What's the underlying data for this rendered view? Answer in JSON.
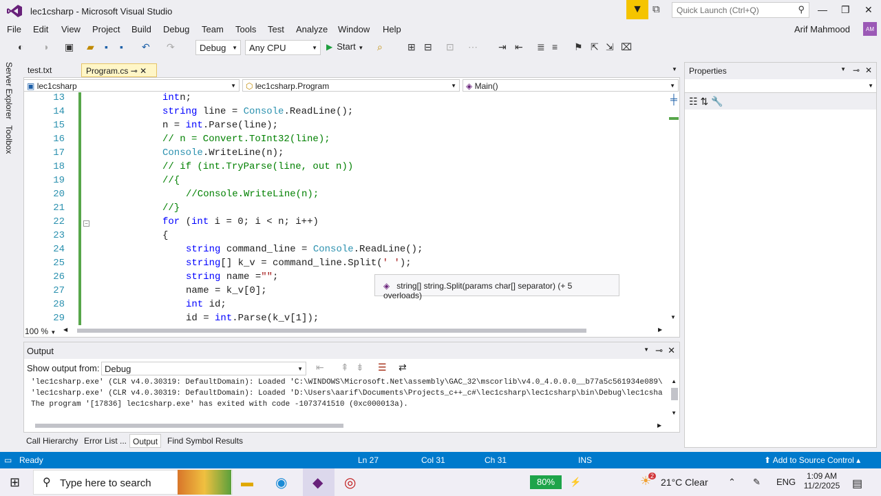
{
  "title": "lec1csharp - Microsoft Visual Studio",
  "quick_launch": {
    "placeholder": "Quick Launch (Ctrl+Q)"
  },
  "menu": [
    "File",
    "Edit",
    "View",
    "Project",
    "Build",
    "Debug",
    "Team",
    "Tools",
    "Test",
    "Analyze",
    "Window",
    "Help"
  ],
  "user": "Arif Mahmood",
  "avatar": "AM",
  "toolbar": {
    "config": "Debug",
    "platform": "Any CPU",
    "start": "Start"
  },
  "side_tabs": [
    "Server Explorer",
    "Toolbox"
  ],
  "doc_tabs": [
    {
      "label": "test.txt"
    },
    {
      "label": "Program.cs",
      "active": true
    }
  ],
  "nav": {
    "project": "lec1csharp",
    "class": "lec1csharp.Program",
    "member": "Main()"
  },
  "code": [
    {
      "n": "13",
      "t": [
        [
          "kw",
          "int"
        ],
        [
          "",
          "n;"
        ]
      ],
      "ind": 0
    },
    {
      "n": "14",
      "t": [
        [
          "kw",
          "string"
        ],
        [
          "",
          " line = "
        ],
        [
          "ty",
          "Console"
        ],
        [
          "",
          ".ReadLine();"
        ]
      ],
      "ind": 0
    },
    {
      "n": "15",
      "t": [
        [
          "",
          "n = "
        ],
        [
          "kw",
          "int"
        ],
        [
          "",
          ".Parse(line);"
        ]
      ],
      "ind": 0
    },
    {
      "n": "16",
      "t": [
        [
          "cm",
          "// n = Convert.ToInt32(line);"
        ]
      ],
      "ind": 0
    },
    {
      "n": "17",
      "t": [
        [
          "ty",
          "Console"
        ],
        [
          "",
          ".WriteLine(n);"
        ]
      ],
      "ind": 0
    },
    {
      "n": "18",
      "t": [
        [
          "cm",
          "// if (int.TryParse(line, out n))"
        ]
      ],
      "ind": 0
    },
    {
      "n": "19",
      "t": [
        [
          "cm",
          "//{"
        ]
      ],
      "ind": 0
    },
    {
      "n": "20",
      "t": [
        [
          "cm",
          "//Console.WriteLine(n);"
        ]
      ],
      "ind": 1
    },
    {
      "n": "21",
      "t": [
        [
          "cm",
          "//}"
        ]
      ],
      "ind": 0
    },
    {
      "n": "22",
      "t": [
        [
          "kw",
          "for"
        ],
        [
          "",
          " ("
        ],
        [
          "kw",
          "int"
        ],
        [
          "",
          " i = 0; i < n; i++)"
        ]
      ],
      "ind": 0
    },
    {
      "n": "23",
      "t": [
        [
          "",
          "{"
        ]
      ],
      "ind": 0
    },
    {
      "n": "24",
      "t": [
        [
          "kw",
          "string"
        ],
        [
          "",
          " command_line = "
        ],
        [
          "ty",
          "Console"
        ],
        [
          "",
          ".ReadLine();"
        ]
      ],
      "ind": 1
    },
    {
      "n": "25",
      "t": [
        [
          "kw",
          "string"
        ],
        [
          "",
          "[] k_v = command_line.Split("
        ],
        [
          "st",
          "' '"
        ],
        [
          "",
          ");"
        ]
      ],
      "ind": 1
    },
    {
      "n": "26",
      "t": [
        [
          "kw",
          "string"
        ],
        [
          "",
          " name ="
        ],
        [
          "st",
          "\"\""
        ],
        [
          "",
          ";"
        ]
      ],
      "ind": 1
    },
    {
      "n": "27",
      "t": [
        [
          "",
          "name = k_v[0];"
        ]
      ],
      "ind": 1
    },
    {
      "n": "28",
      "t": [
        [
          "kw",
          "int"
        ],
        [
          "",
          " id;"
        ]
      ],
      "ind": 1
    },
    {
      "n": "29",
      "t": [
        [
          "",
          "id = "
        ],
        [
          "kw",
          "int"
        ],
        [
          "",
          ".Parse(k_v[1]);"
        ]
      ],
      "ind": 1
    }
  ],
  "tooltip": "string[] string.Split(params char[] separator) (+ 5 overloads)",
  "zoom": "100 %",
  "properties": {
    "title": "Properties"
  },
  "output": {
    "title": "Output",
    "show_label": "Show output from:",
    "source": "Debug",
    "lines": [
      "'lec1csharp.exe' (CLR v4.0.30319: DefaultDomain): Loaded 'C:\\WINDOWS\\Microsoft.Net\\assembly\\GAC_32\\mscorlib\\v4.0_4.0.0.0__b77a5c561934e089\\",
      "'lec1csharp.exe' (CLR v4.0.30319: DefaultDomain): Loaded 'D:\\Users\\aarif\\Documents\\Projects_c++_c#\\lec1csharp\\lec1csharp\\bin\\Debug\\lec1csha",
      "The program '[17836] lec1csharp.exe' has exited with code -1073741510 (0xc000013a)."
    ]
  },
  "bottom_tabs": [
    "Call Hierarchy",
    "Error List ...",
    "Output",
    "Find Symbol Results"
  ],
  "status": {
    "ready": "Ready",
    "ln": "Ln 27",
    "col": "Col 31",
    "ch": "Ch 31",
    "ins": "INS",
    "source_control": "Add to Source Control"
  },
  "taskbar": {
    "search": "Type here to search",
    "battery": "80%",
    "weather": "21°C  Clear",
    "badge": "2",
    "lang": "ENG",
    "time": "1:09 AM",
    "date": "11/2/2025"
  }
}
